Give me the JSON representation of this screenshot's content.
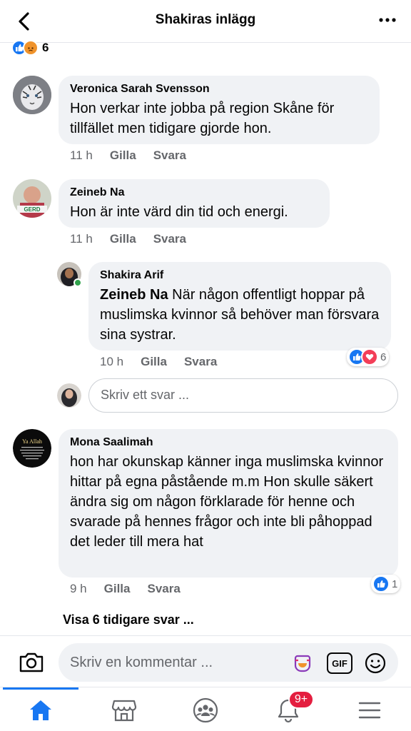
{
  "header": {
    "title": "Shakiras inlägg"
  },
  "post_reactions": {
    "count": "6"
  },
  "comments": [
    {
      "name": "Veronica Sarah Svensson",
      "text": "Hon verkar inte jobba på region Skåne för tillfället men tidigare gjorde hon.",
      "time": "11 h",
      "like_label": "Gilla",
      "reply_label": "Svara"
    },
    {
      "name": "Zeineb Na",
      "text": "Hon är inte värd din tid och energi.",
      "time": "11 h",
      "like_label": "Gilla",
      "reply_label": "Svara"
    },
    {
      "name": "Shakira Arif",
      "mention": "Zeineb Na",
      "text": " När någon offentligt hoppar på muslimska kvinnor så behöver man försvara sina systrar.",
      "time": "10 h",
      "like_label": "Gilla",
      "reply_label": "Svara",
      "reaction_count": "6"
    },
    {
      "name": "Mona Saalimah",
      "text": "hon har okunskap känner inga muslimska kvinnor hittar på egna påstående m.m Hon skulle säkert ändra sig om någon förklarade för henne och svarade på hennes frågor och inte bli påhoppad det leder till mera hat",
      "time": "9 h",
      "like_label": "Gilla",
      "reply_label": "Svara",
      "reaction_count": "1"
    }
  ],
  "reply_input": {
    "placeholder": "Skriv ett svar ..."
  },
  "show_more": "Visa 6 tidigare svar ...",
  "composer": {
    "placeholder": "Skriv en kommentar ...",
    "gif_label": "GIF"
  },
  "avatar_text": {
    "zeineb": "GERD",
    "mona": "Ya Allah"
  },
  "bottom_nav": {
    "items": [
      "home-icon",
      "marketplace-icon",
      "groups-icon",
      "notifications-icon",
      "menu-icon"
    ],
    "notification_badge": "9+"
  },
  "colors": {
    "accent": "#1877f2",
    "bubble": "#f0f2f5",
    "muted": "#65676b",
    "badge": "#e41e3f"
  }
}
